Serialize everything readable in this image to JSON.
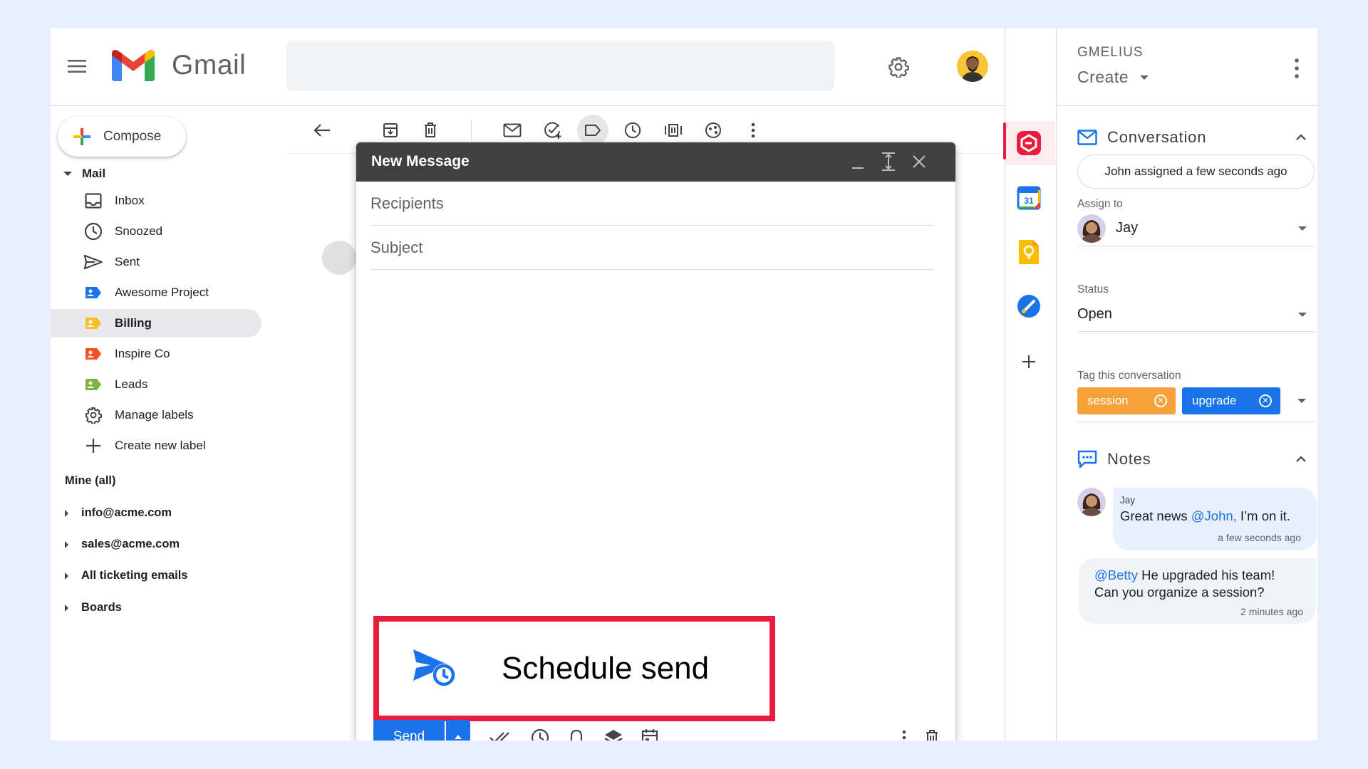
{
  "gmail": {
    "app_name": "Gmail",
    "compose_label": "Compose",
    "mail_section": "Mail",
    "nav": [
      {
        "label": "Inbox",
        "icon": "inbox-icon"
      },
      {
        "label": "Snoozed",
        "icon": "clock-icon"
      },
      {
        "label": "Sent",
        "icon": "send-icon"
      },
      {
        "label": "Awesome Project",
        "icon": "label-icon"
      },
      {
        "label": "Billing",
        "icon": "label-icon"
      },
      {
        "label": "Inspire Co",
        "icon": "label-icon"
      },
      {
        "label": "Leads",
        "icon": "label-icon"
      },
      {
        "label": "Manage labels",
        "icon": "gear-icon"
      },
      {
        "label": "Create new label",
        "icon": "plus-icon"
      }
    ],
    "mine_header": "Mine (all)",
    "accounts": [
      "info@acme.com",
      "sales@acme.com",
      "All ticketing emails",
      "Boards"
    ],
    "label_colors": {
      "awesome": "#1a73e8",
      "billing": "#f6bf26",
      "inspire": "#f4511e",
      "leads": "#7cb342"
    }
  },
  "compose": {
    "title": "New Message",
    "recipients_placeholder": "Recipients",
    "subject_placeholder": "Subject",
    "send_label": "Send",
    "schedule_label": "Schedule send"
  },
  "gmelius": {
    "brand": "GMELIUS",
    "create_label": "Create",
    "conversation": {
      "title": "Conversation",
      "assigned_text": "John assigned a few seconds ago",
      "assign_label": "Assign to",
      "assignee": "Jay",
      "status_label": "Status",
      "status_value": "Open",
      "tag_label": "Tag this conversation",
      "tags": [
        {
          "name": "session",
          "color": "#f6a23a"
        },
        {
          "name": "upgrade",
          "color": "#1a73e8"
        }
      ]
    },
    "notes": {
      "title": "Notes",
      "items": [
        {
          "author": "Jay",
          "text_prefix": "Great news ",
          "mention": "@John,",
          "text_suffix": " I’m on it.",
          "time": "a few seconds ago"
        },
        {
          "mention": "@Betty",
          "text": " He upgraded his team! Can you organize a session?",
          "time": "2 minutes ago"
        }
      ]
    }
  },
  "colors": {
    "accent_blue": "#1a73e8",
    "highlight_red": "#ea1c3d",
    "header_dark": "#404040"
  }
}
